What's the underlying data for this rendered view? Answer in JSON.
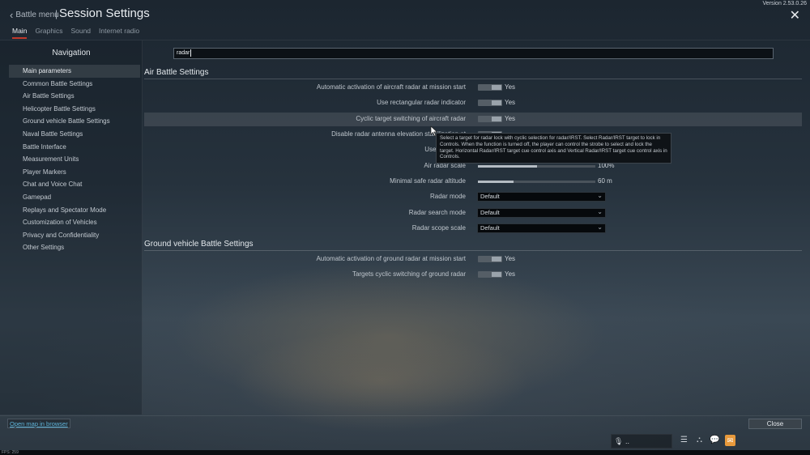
{
  "header": {
    "back_label": "Battle menu",
    "separator": "|",
    "title": "Session Settings",
    "version": "Version 2.53.0.26",
    "close_glyph": "✕"
  },
  "tabs": [
    {
      "label": "Main",
      "active": true
    },
    {
      "label": "Graphics"
    },
    {
      "label": "Sound"
    },
    {
      "label": "Internet radio"
    }
  ],
  "navigation": {
    "title": "Navigation",
    "items": [
      {
        "label": "Main parameters",
        "selected": true
      },
      {
        "label": "Common Battle Settings"
      },
      {
        "label": "Air Battle Settings"
      },
      {
        "label": "Helicopter Battle Settings"
      },
      {
        "label": "Ground vehicle Battle Settings"
      },
      {
        "label": "Naval Battle Settings"
      },
      {
        "label": "Battle Interface"
      },
      {
        "label": "Measurement Units"
      },
      {
        "label": "Player Markers"
      },
      {
        "label": "Chat and Voice Chat"
      },
      {
        "label": "Gamepad"
      },
      {
        "label": "Replays and Spectator Mode"
      },
      {
        "label": "Customization of Vehicles"
      },
      {
        "label": "Privacy and Confidentiality"
      },
      {
        "label": "Other Settings"
      }
    ]
  },
  "search": {
    "value": "radar"
  },
  "sections": {
    "air": {
      "title": "Air Battle Settings",
      "rows": [
        {
          "label": "Automatic activation of aircraft radar at mission start",
          "value": "Yes"
        },
        {
          "label": "Use rectangular radar indicator",
          "value": "Yes"
        },
        {
          "label": "Cyclic target switching of aircraft radar",
          "value": "Yes"
        },
        {
          "label": "Disable radar antenna elevation stabilization at"
        },
        {
          "label": "Use radar hud"
        },
        {
          "label": "Air radar scale",
          "value": "100%",
          "level": 0.5
        },
        {
          "label": "Minimal safe radar altitude",
          "value": "60 m",
          "level": 0.3
        },
        {
          "label": "Radar mode",
          "value": "Default"
        },
        {
          "label": "Radar search mode",
          "value": "Default"
        },
        {
          "label": "Radar scope scale",
          "value": "Default"
        }
      ]
    },
    "ground": {
      "title": "Ground vehicle Battle Settings",
      "rows": [
        {
          "label": "Automatic activation of ground radar at mission start",
          "value": "Yes"
        },
        {
          "label": "Targets cyclic switching of ground radar",
          "value": "Yes"
        }
      ]
    }
  },
  "tooltip": {
    "text": "Select a target for radar lock with cyclic selection for radar/IRST. Select Radar/IRST target to lock in Controls. When the function is turned off, the player can control the strobe to select and lock the target. Horizontal Radar/IRST target cue control axis and Vertical Radar/IRST target cue control axis in Controls."
  },
  "footer": {
    "open_map": "Open map in browser",
    "close": "Close",
    "mic_label": "..",
    "fps": "FPS: 259"
  },
  "icons": [
    "chevron-left-icon",
    "close-icon",
    "microphone-icon",
    "list-icon",
    "squad-icon",
    "chat-icon",
    "mail-icon",
    "cursor-icon"
  ]
}
